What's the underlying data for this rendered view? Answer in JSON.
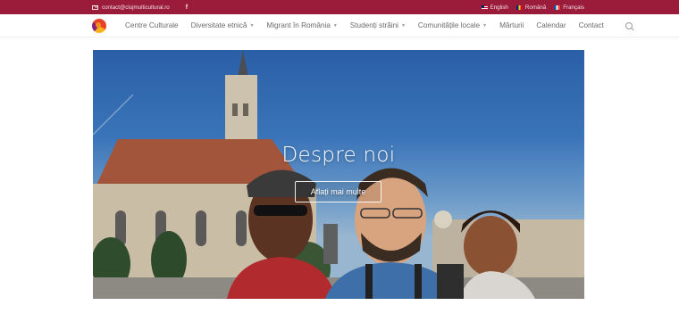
{
  "topbar": {
    "email": "contact@clujmulticultural.ro",
    "facebook_icon": "f",
    "languages": [
      {
        "label": "English",
        "flag": "flag-en-icon"
      },
      {
        "label": "Română",
        "flag": "flag-ro-icon"
      },
      {
        "label": "Français",
        "flag": "flag-fr-icon"
      }
    ]
  },
  "nav": {
    "items": [
      {
        "label": "Centre Culturale",
        "dropdown": false
      },
      {
        "label": "Diversitate etnică",
        "dropdown": true
      },
      {
        "label": "Migrant în România",
        "dropdown": true
      },
      {
        "label": "Studenți străini",
        "dropdown": true
      },
      {
        "label": "Comunitățile locale",
        "dropdown": true
      },
      {
        "label": "Mărturii",
        "dropdown": false
      },
      {
        "label": "Calendar",
        "dropdown": false
      },
      {
        "label": "Contact",
        "dropdown": false
      }
    ]
  },
  "hero": {
    "title": "Despre noi",
    "button": "Aflați mai multe"
  },
  "colors": {
    "topbar": "#9b1b3b",
    "nav_text": "#6b6b6b"
  }
}
